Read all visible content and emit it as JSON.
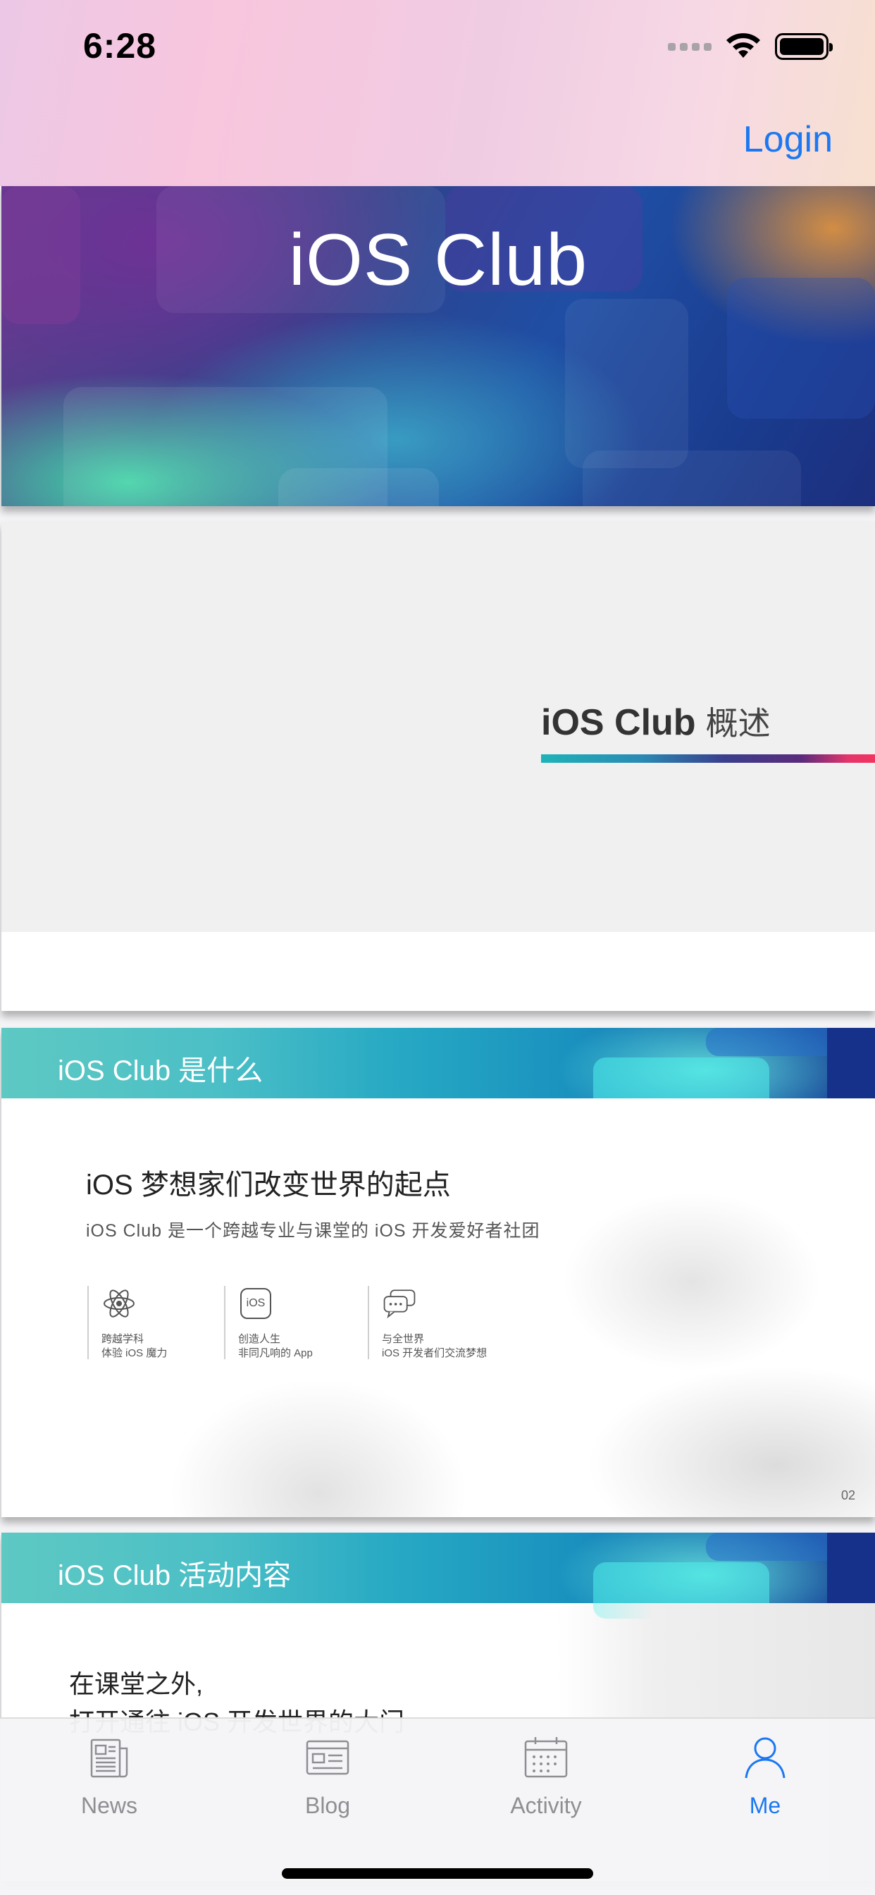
{
  "status_bar": {
    "time": "6:28"
  },
  "nav": {
    "login_label": "Login"
  },
  "banner": {
    "title": "iOS Club"
  },
  "slide_overview": {
    "title_bold": "iOS Club",
    "title_sub": "概述"
  },
  "slide_what": {
    "header": "iOS Club 是什么",
    "headline": "iOS 梦想家们改变世界的起点",
    "subline": "iOS Club 是一个跨越专业与课堂的 iOS 开发爱好者社团",
    "features": [
      {
        "icon": "atom-icon",
        "line1": "跨越学科",
        "line2": "体验 iOS 魔力"
      },
      {
        "icon": "ios-badge-icon",
        "badge_text": "iOS",
        "line1": "创造人生",
        "line2": "非同凡响的 App"
      },
      {
        "icon": "chat-bubbles-icon",
        "line1": "与全世界",
        "line2": "iOS 开发者们交流梦想"
      }
    ],
    "page_number": "02"
  },
  "slide_activity": {
    "header": "iOS Club 活动内容",
    "line1": "在课堂之外,",
    "line2": "打开通往 iOS 开发世界的大门"
  },
  "tab_bar": {
    "active_color": "#1b78f0",
    "inactive_color": "#8e8e93",
    "tabs": [
      {
        "label": "News",
        "icon": "newspaper-icon",
        "active": false
      },
      {
        "label": "Blog",
        "icon": "blog-icon",
        "active": false
      },
      {
        "label": "Activity",
        "icon": "calendar-icon",
        "active": false
      },
      {
        "label": "Me",
        "icon": "person-icon",
        "active": true
      }
    ]
  }
}
